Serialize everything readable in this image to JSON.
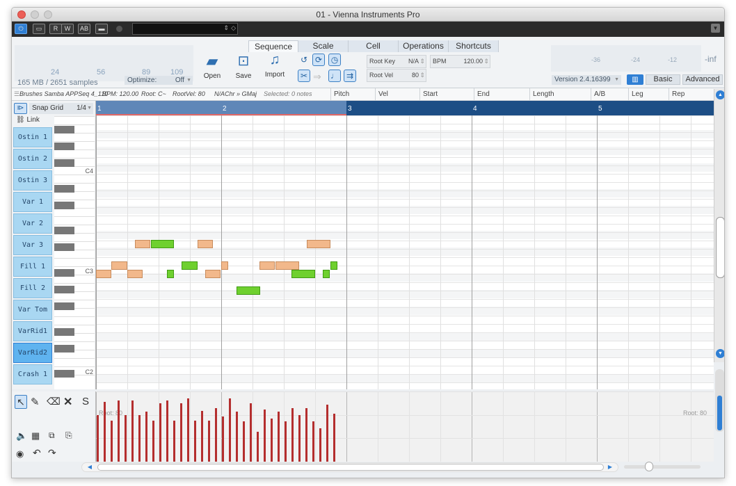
{
  "window_title": "01 - Vienna Instruments Pro",
  "toolbar": {
    "buttons": [
      "R",
      "W"
    ],
    "power": "⏻"
  },
  "header": {
    "memory": "165 MB / 2651 samples",
    "ruler_ticks": [
      "24",
      "56",
      "89",
      "109"
    ],
    "optimize_label": "Optimize:",
    "optimize_value": "Off",
    "file_buttons": [
      {
        "label": "Open"
      },
      {
        "label": "Save"
      },
      {
        "label": "Import"
      }
    ],
    "tabs": [
      "Sequence",
      "Scale",
      "Cell",
      "Operations",
      "Shortcuts"
    ],
    "root_key_label": "Root Key",
    "root_key_value": "N/A",
    "bpm_label": "BPM",
    "bpm_value": "120.00",
    "root_vel_label": "Root Vel",
    "root_vel_value": "80",
    "meter_labels": [
      "-36",
      "-24",
      "-12",
      "-inf"
    ],
    "version": "Version 2.4.16399",
    "mode_basic": "Basic",
    "mode_advanced": "Advanced"
  },
  "infobar": {
    "seq_name": "Brushes Samba APPSeq 4_110",
    "bpm": "BPM: 120.00",
    "root": "Root: C~",
    "rootvel": "RootVel: 80",
    "chord": "N/AChr » GMaj",
    "selected": "Selected: 0 notes",
    "columns": [
      "Pitch",
      "Vel",
      "Start",
      "End",
      "Length",
      "A/B",
      "Leg",
      "Rep"
    ]
  },
  "left": {
    "snap_label": "Snap Grid",
    "snap_value": "1/4",
    "link_label": "Link",
    "patterns": [
      "Ostin 1",
      "Ostin 2",
      "Ostin 3",
      "Var 1",
      "Var 2",
      "Var 3",
      "Fill 1",
      "Fill 2",
      "Var Tom",
      "VarRid1",
      "VarRid2",
      "Crash 1"
    ],
    "selected_pattern": "VarRid2",
    "key_labels": [
      "C4",
      "C3",
      "C2"
    ]
  },
  "timeline": {
    "bars": [
      "1",
      "2",
      "3",
      "4",
      "5"
    ]
  },
  "velocity": {
    "root_left": "Root: 80",
    "root_right": "Root: 80",
    "values": [
      70,
      90,
      62,
      92,
      70,
      92,
      70,
      75,
      62,
      88,
      92,
      62,
      88,
      95,
      62,
      76,
      62,
      80,
      68,
      95,
      75,
      60,
      88,
      45,
      78,
      65,
      75,
      60,
      80,
      70,
      80,
      60,
      50,
      85,
      72
    ]
  },
  "tools": {
    "s_label": "S"
  },
  "colors": {
    "accent": "#2f7fd4",
    "note_orange": "#f2b88b",
    "note_green": "#6fd02f",
    "bar_red": "#b42e2e",
    "timeline_active": "#5f87b8",
    "timeline_dark": "#1d4e85"
  }
}
